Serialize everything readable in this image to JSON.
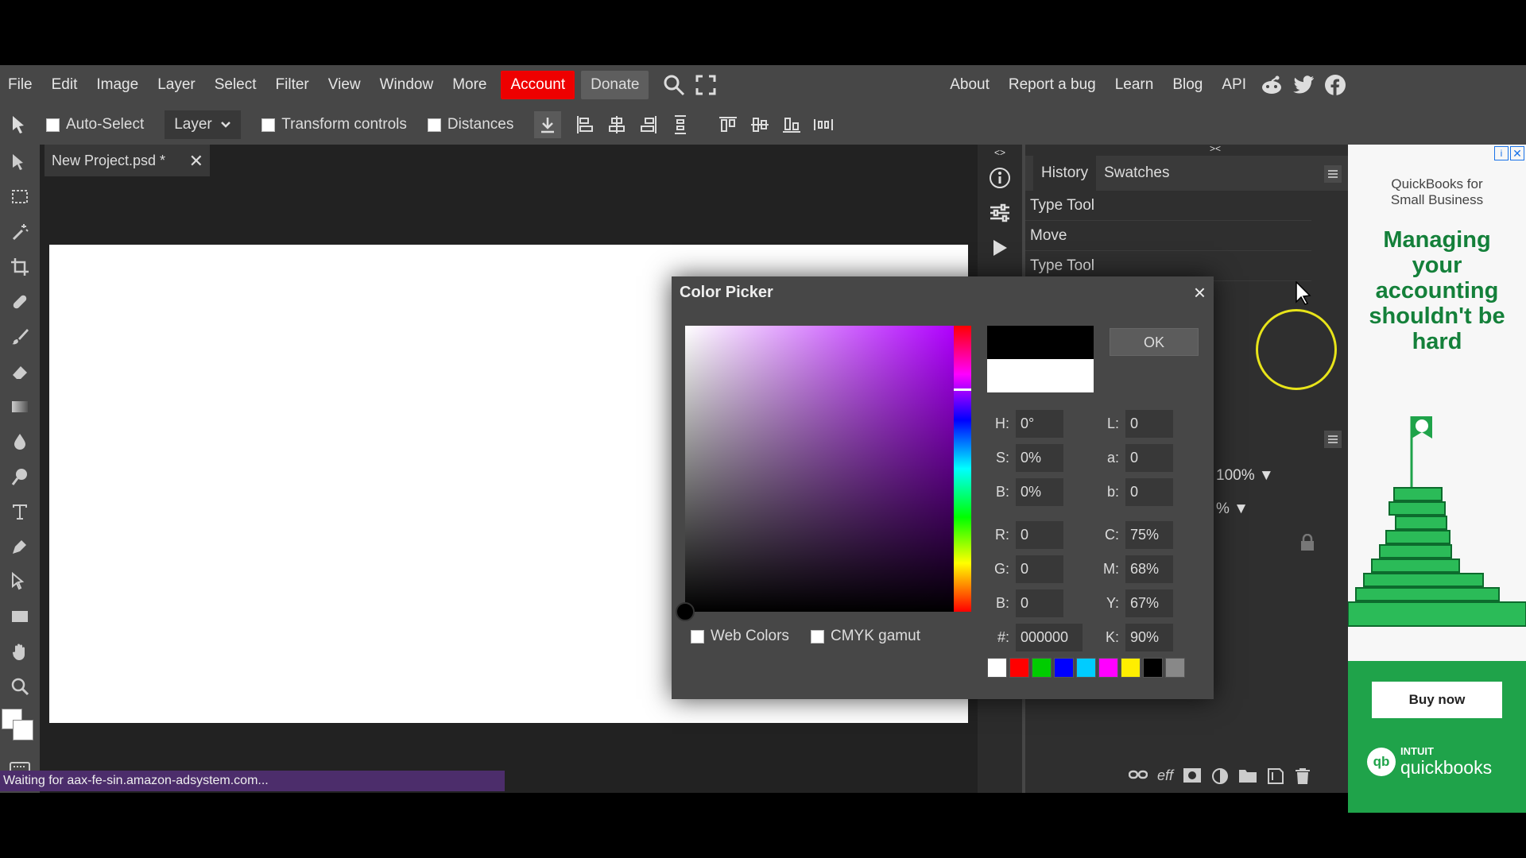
{
  "menu": {
    "items": [
      "File",
      "Edit",
      "Image",
      "Layer",
      "Select",
      "Filter",
      "View",
      "Window",
      "More"
    ],
    "account": "Account",
    "donate": "Donate",
    "right_items": [
      "About",
      "Report a bug",
      "Learn",
      "Blog",
      "API"
    ]
  },
  "options": {
    "auto_select": "Auto-Select",
    "layer_select": "Layer",
    "transform_controls": "Transform controls",
    "distances": "Distances"
  },
  "document": {
    "tab_title": "New Project.psd *"
  },
  "status": "Waiting for aax-fe-sin.amazon-adsystem.com...",
  "panel": {
    "tabs": [
      "History",
      "Swatches"
    ],
    "history": [
      "Type Tool",
      "Move",
      "Type Tool"
    ],
    "opacity": "100%",
    "fill": "%"
  },
  "ad": {
    "brand_top": "QuickBooks for Small Business",
    "headline": "Managing your accounting shouldn't be hard",
    "cta": "Buy now",
    "logo_top": "INTUIT",
    "logo_bottom": "quickbooks"
  },
  "picker": {
    "title": "Color Picker",
    "ok": "OK",
    "hue_level": 0.22,
    "fields": {
      "H": "0°",
      "S": "0%",
      "B": "0%",
      "L": "0",
      "a": "0",
      "b": "0",
      "R": "0",
      "G": "0",
      "B2": "0",
      "C": "75%",
      "M": "68%",
      "Y": "67%",
      "hex": "000000",
      "K": "90%"
    },
    "web_colors": "Web Colors",
    "cmyk_gamut": "CMYK gamut",
    "palette": [
      "#ffffff",
      "#ff0000",
      "#00cc00",
      "#0000ff",
      "#00ccff",
      "#ff00ff",
      "#ffee00",
      "#000000",
      "#888888"
    ]
  }
}
